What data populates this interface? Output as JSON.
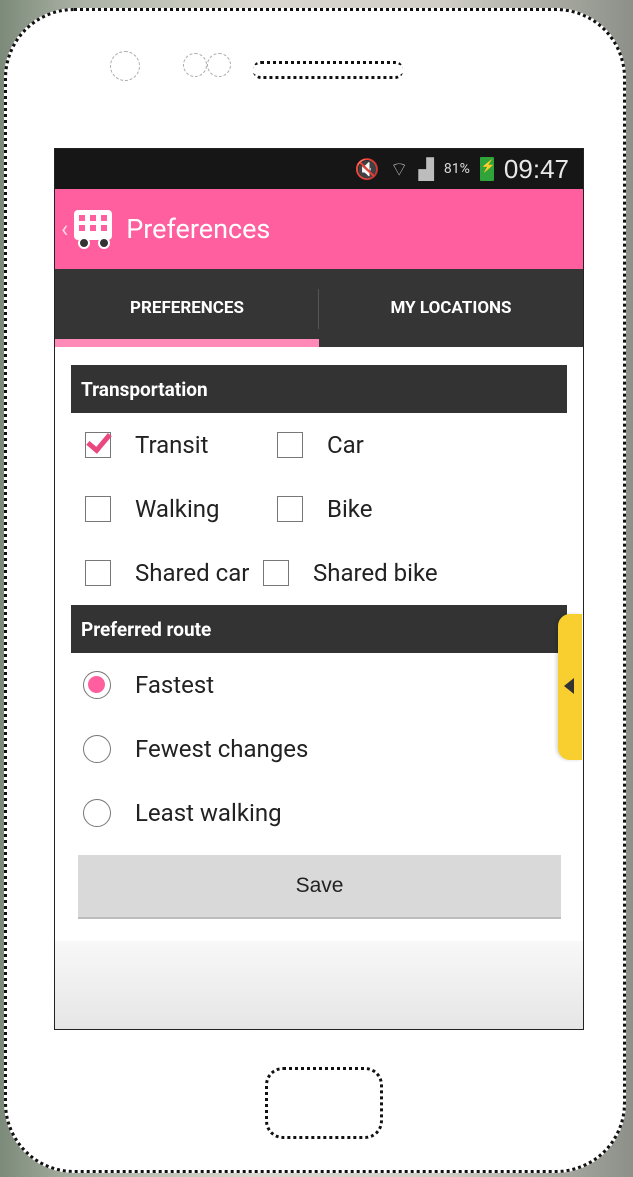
{
  "status_bar": {
    "battery_percent": "81%",
    "time": "09:47",
    "icons": [
      "mute-icon",
      "wifi-icon",
      "signal-icon",
      "battery-charging-icon"
    ]
  },
  "action_bar": {
    "title": "Preferences",
    "back_glyph": "‹",
    "accent_color": "#ff5f9f"
  },
  "tabs": [
    {
      "label": "PREFERENCES",
      "active": true
    },
    {
      "label": "MY LOCATIONS",
      "active": false
    }
  ],
  "transportation": {
    "header": "Transportation",
    "options": [
      {
        "label": "Transit",
        "checked": true
      },
      {
        "label": "Car",
        "checked": false
      },
      {
        "label": "Walking",
        "checked": false
      },
      {
        "label": "Bike",
        "checked": false
      },
      {
        "label": "Shared car",
        "checked": false
      },
      {
        "label": "Shared bike",
        "checked": false
      }
    ]
  },
  "preferred_route": {
    "header": "Preferred route",
    "options": [
      {
        "label": "Fastest",
        "selected": true
      },
      {
        "label": "Fewest changes",
        "selected": false
      },
      {
        "label": "Least walking",
        "selected": false
      }
    ]
  },
  "save_label": "Save"
}
